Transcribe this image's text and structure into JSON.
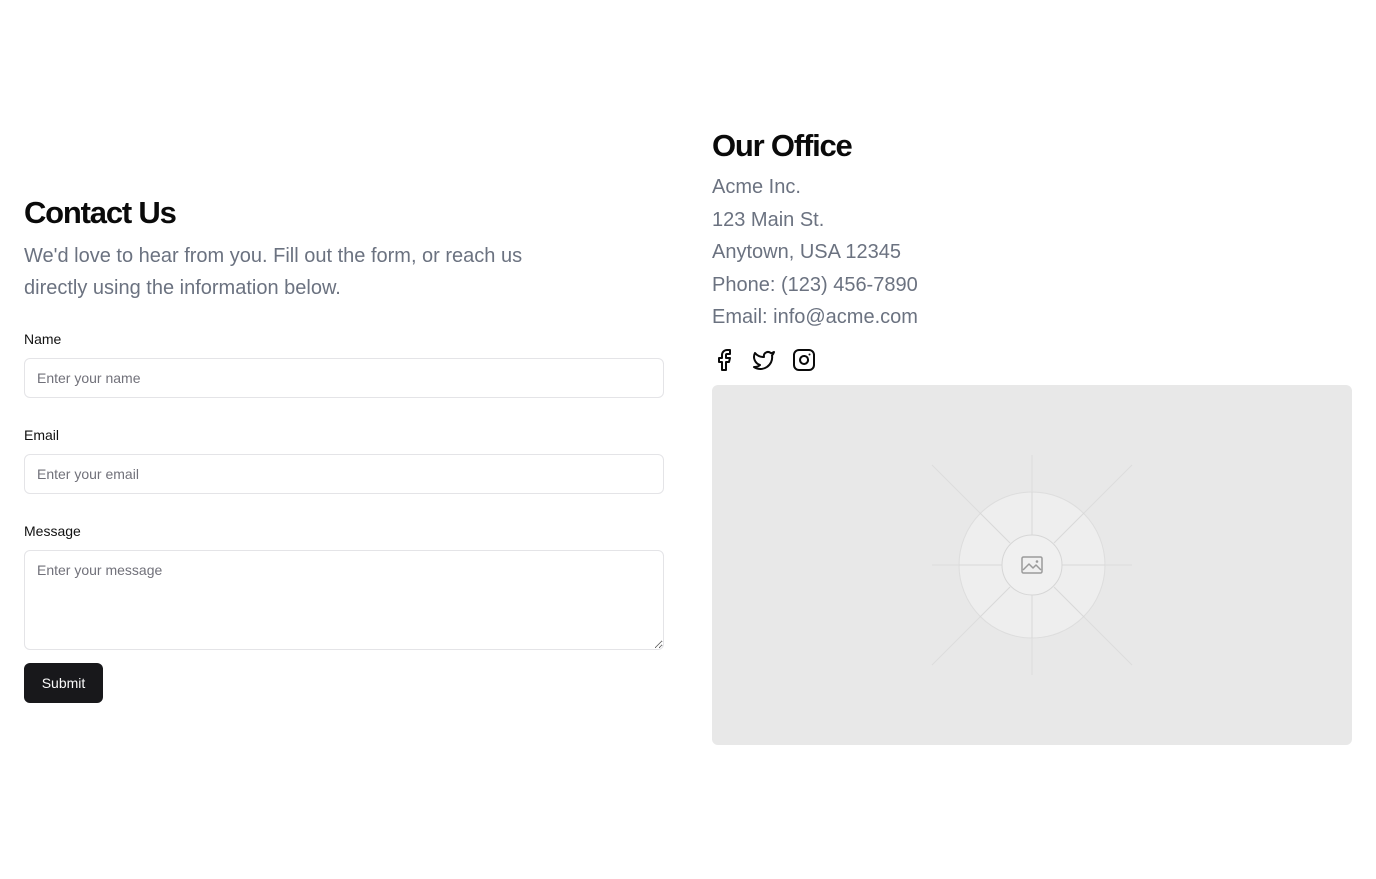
{
  "contact": {
    "title": "Contact Us",
    "lead": "We'd love to hear from you. Fill out the form, or reach us directly using the information below.",
    "fields": {
      "name": {
        "label": "Name",
        "placeholder": "Enter your name"
      },
      "email": {
        "label": "Email",
        "placeholder": "Enter your email"
      },
      "message": {
        "label": "Message",
        "placeholder": "Enter your message"
      }
    },
    "submit_label": "Submit"
  },
  "office": {
    "title": "Our Office",
    "lines": [
      "Acme Inc.",
      "123 Main St.",
      "Anytown, USA 12345",
      "Phone: (123) 456-7890",
      "Email: info@acme.com"
    ],
    "socials": [
      "facebook-icon",
      "twitter-icon",
      "instagram-icon"
    ],
    "map_placeholder_icon": "image-icon"
  },
  "colors": {
    "muted_text": "#6b7280",
    "button_bg": "#18181b",
    "input_border": "#e4e4e7",
    "placeholder_bg": "#e8e8e8"
  }
}
